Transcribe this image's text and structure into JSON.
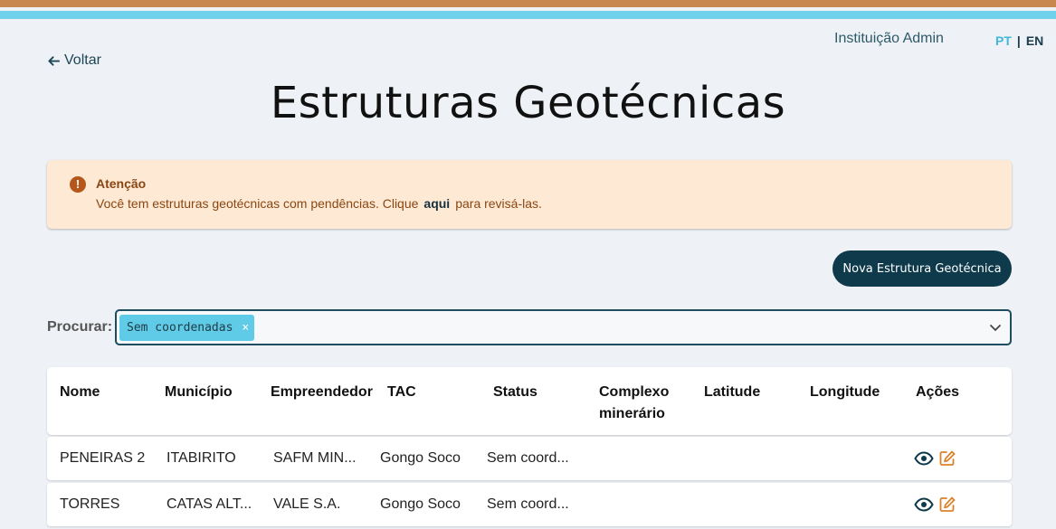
{
  "header": {
    "user_name": "Instituição Admin",
    "lang_pt": "PT",
    "lang_sep": "|",
    "lang_en": "EN",
    "back_label": "Voltar"
  },
  "page": {
    "title": "Estruturas Geotécnicas"
  },
  "alert": {
    "title": "Atenção",
    "text_before": "Você tem estruturas geotécnicas com pendências. Clique",
    "link": "aqui",
    "text_after": "para revisá-las.",
    "icon": "!"
  },
  "actions": {
    "new_button": "Nova Estrutura Geotécnica"
  },
  "search": {
    "label": "Procurar:",
    "chip": "Sem coordenadas",
    "chip_remove": "×"
  },
  "table": {
    "columns": [
      "Nome",
      "Município",
      "Empreendedor",
      "TAC",
      "Status",
      "Complexo minerário",
      "Latitude",
      "Longitude",
      "Ações"
    ],
    "rows": [
      {
        "nome": "PENEIRAS 2",
        "municipio": "ITABIRITO",
        "empreendedor": "SAFM MIN...",
        "tac": "Gongo Soco",
        "status": "Sem coord..."
      },
      {
        "nome": "TORRES",
        "municipio": "CATAS ALT...",
        "empreendedor": "VALE S.A.",
        "tac": "Gongo Soco",
        "status": "Sem coord..."
      }
    ]
  },
  "colors": {
    "top_bar_orange": "#c8874f",
    "top_bar_cyan": "#6fd2ea",
    "primary_dark": "#0e3a4b",
    "chip_bg": "#5fcbe6",
    "alert_bg": "#fde9d4",
    "edit_icon": "#d9822b"
  },
  "icons": {
    "back": "arrow-left-icon",
    "alert": "exclamation-circle-icon",
    "dropdown": "chevron-down-icon",
    "view": "eye-icon",
    "edit": "edit-icon"
  }
}
